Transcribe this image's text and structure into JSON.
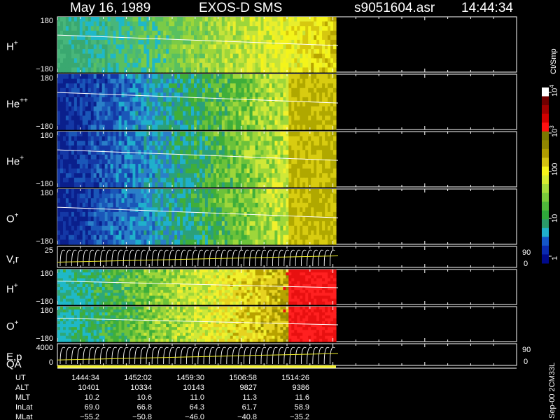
{
  "header": {
    "date": "May 16, 1989",
    "instrument": "EXOS-D SMS",
    "file": "s9051604.asr",
    "time": "14:44:34"
  },
  "colorbar": {
    "label": "Ct/Smp",
    "ticks": [
      "1",
      "10",
      "100",
      "10",
      "10"
    ],
    "exponents": [
      "",
      "",
      "",
      "3",
      "4"
    ]
  },
  "footer_side_label": "Sep-00 2CM33L",
  "chart_data": {
    "type": "heatmap",
    "panels": [
      {
        "id": "h1",
        "label": "H",
        "sup": "+",
        "ticks": [
          "180",
          "−180"
        ],
        "palette": "hplus"
      },
      {
        "id": "he2",
        "label": "He",
        "sup": "++",
        "ticks": [
          "180",
          "−180"
        ],
        "palette": "cool"
      },
      {
        "id": "he1",
        "label": "He",
        "sup": "+",
        "ticks": [
          "180",
          "−180"
        ],
        "palette": "cool"
      },
      {
        "id": "o1",
        "label": "O",
        "sup": "+",
        "ticks": [
          "180",
          "−180"
        ],
        "palette": "cool"
      },
      {
        "id": "vr",
        "label": "V,r",
        "sup": "",
        "ticks": [
          "25",
          ""
        ],
        "right_ticks": [
          "90",
          "0"
        ],
        "palette": "lines"
      },
      {
        "id": "h2",
        "label": "H",
        "sup": "+",
        "ticks": [
          "180",
          "−180"
        ],
        "palette": "warm"
      },
      {
        "id": "o2",
        "label": "O",
        "sup": "+",
        "ticks": [
          "180",
          "−180"
        ],
        "palette": "warm"
      },
      {
        "id": "ep",
        "label": "E,p",
        "sup": "",
        "ticks": [
          "4000",
          "0"
        ],
        "right_ticks": [
          "90",
          "0"
        ],
        "palette": "lines"
      }
    ],
    "qa_label": "QA",
    "x_labels": [
      "1444:34",
      "1452:02",
      "1459:30",
      "1506:58",
      "1514:26"
    ],
    "rows": [
      {
        "name": "UT",
        "values": [
          "1444:34",
          "1452:02",
          "1459:30",
          "1506:58",
          "1514:26"
        ]
      },
      {
        "name": "ALT",
        "values": [
          "10401",
          "10334",
          "10143",
          "9827",
          "9386"
        ]
      },
      {
        "name": "MLT",
        "values": [
          "10.2",
          "10.6",
          "11.0",
          "11.3",
          "11.6"
        ]
      },
      {
        "name": "InLat",
        "values": [
          "69.0",
          "66.8",
          "64.3",
          "61.7",
          "58.9"
        ]
      },
      {
        "name": "MLat",
        "values": [
          "−55.2",
          "−50.8",
          "−46.0",
          "−40.8",
          "−35.2"
        ]
      }
    ]
  }
}
